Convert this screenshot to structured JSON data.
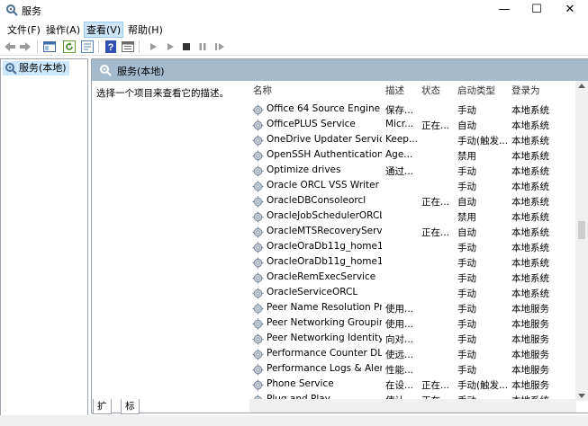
{
  "window": {
    "title": "服务",
    "minimize": "—",
    "maximize": "☐",
    "close": "✕"
  },
  "menu": {
    "items": [
      "文件(F)",
      "操作(A)",
      "查看(V)",
      "帮助(H)"
    ]
  },
  "tree": {
    "root_label": "服务(本地)"
  },
  "right_header": {
    "label": "服务(本地)"
  },
  "description_hint": "选择一个项目来查看它的描述。",
  "columns": {
    "name": "名称",
    "desc": "描述",
    "status": "状态",
    "startup": "启动类型",
    "logon": "登录为"
  },
  "services": [
    {
      "name": "Office 64 Source Engine",
      "desc": "保存...",
      "status": "",
      "startup": "手动",
      "logon": "本地系统"
    },
    {
      "name": "OfficePLUS Service",
      "desc": "Micr...",
      "status": "正在...",
      "startup": "自动",
      "logon": "本地系统"
    },
    {
      "name": "OneDrive Updater Service",
      "desc": "Keep...",
      "status": "",
      "startup": "手动(触发...",
      "logon": "本地系统"
    },
    {
      "name": "OpenSSH Authentication ...",
      "desc": "Age...",
      "status": "",
      "startup": "禁用",
      "logon": "本地系统"
    },
    {
      "name": "Optimize drives",
      "desc": "通过...",
      "status": "",
      "startup": "手动",
      "logon": "本地系统"
    },
    {
      "name": "Oracle ORCL VSS Writer S...",
      "desc": "",
      "status": "",
      "startup": "手动",
      "logon": "本地系统"
    },
    {
      "name": "OracleDBConsoleorcl",
      "desc": "",
      "status": "正在...",
      "startup": "自动",
      "logon": "本地系统"
    },
    {
      "name": "OracleJobSchedulerORCL",
      "desc": "",
      "status": "",
      "startup": "禁用",
      "logon": "本地系统"
    },
    {
      "name": "OracleMTSRecoveryService",
      "desc": "",
      "status": "正在...",
      "startup": "自动",
      "logon": "本地系统"
    },
    {
      "name": "OracleOraDb11g_home1C...",
      "desc": "",
      "status": "",
      "startup": "手动",
      "logon": "本地系统"
    },
    {
      "name": "OracleOraDb11g_home1T...",
      "desc": "",
      "status": "",
      "startup": "手动",
      "logon": "本地系统"
    },
    {
      "name": "OracleRemExecService",
      "desc": "",
      "status": "",
      "startup": "手动",
      "logon": "本地系统"
    },
    {
      "name": "OracleServiceORCL",
      "desc": "",
      "status": "",
      "startup": "手动",
      "logon": "本地系统"
    },
    {
      "name": "Peer Name Resolution Pro...",
      "desc": "使用...",
      "status": "",
      "startup": "手动",
      "logon": "本地服务"
    },
    {
      "name": "Peer Networking Grouping",
      "desc": "使用...",
      "status": "",
      "startup": "手动",
      "logon": "本地服务"
    },
    {
      "name": "Peer Networking Identity ...",
      "desc": "向对...",
      "status": "",
      "startup": "手动",
      "logon": "本地服务"
    },
    {
      "name": "Performance Counter DLL ...",
      "desc": "使远...",
      "status": "",
      "startup": "手动",
      "logon": "本地服务"
    },
    {
      "name": "Performance Logs & Alerts",
      "desc": "性能...",
      "status": "",
      "startup": "手动",
      "logon": "本地服务"
    },
    {
      "name": "Phone Service",
      "desc": "在设...",
      "status": "正在...",
      "startup": "手动(触发...",
      "logon": "本地服务"
    },
    {
      "name": "Plug and Play",
      "desc": "使计...",
      "status": "正在...",
      "startup": "手动",
      "logon": "本地系统"
    }
  ],
  "tabs": [
    "扩展",
    "标准"
  ],
  "colors": {
    "header_band": "#a6bacd",
    "selection": "#cce8ff",
    "menu_active": "#cce4f7"
  }
}
